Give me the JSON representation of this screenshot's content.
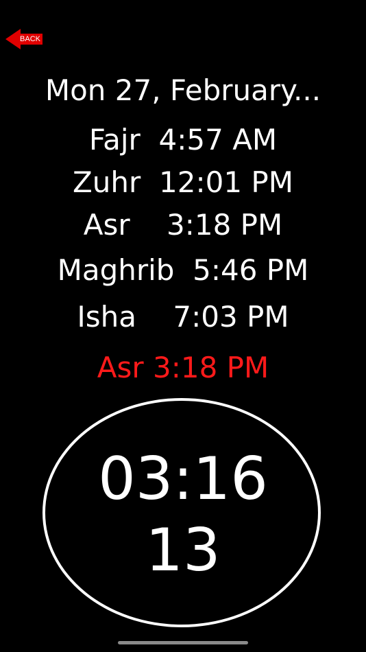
{
  "header": {
    "back_label": "BACK"
  },
  "date_heading": "Mon 27, February...",
  "prayers": [
    {
      "text": "Fajr  4:57 AM"
    },
    {
      "text": "Zuhr  12:01 PM"
    },
    {
      "text": "Asr    3:18 PM"
    },
    {
      "text": "Maghrib  5:46 PM"
    },
    {
      "text": "Isha    7:03 PM"
    }
  ],
  "next_prayer": "Asr 3:18 PM",
  "countdown": {
    "time": "03:16",
    "seconds": "13"
  },
  "colors": {
    "background": "#000000",
    "text": "#ffffff",
    "accent": "#ff1a1a"
  }
}
